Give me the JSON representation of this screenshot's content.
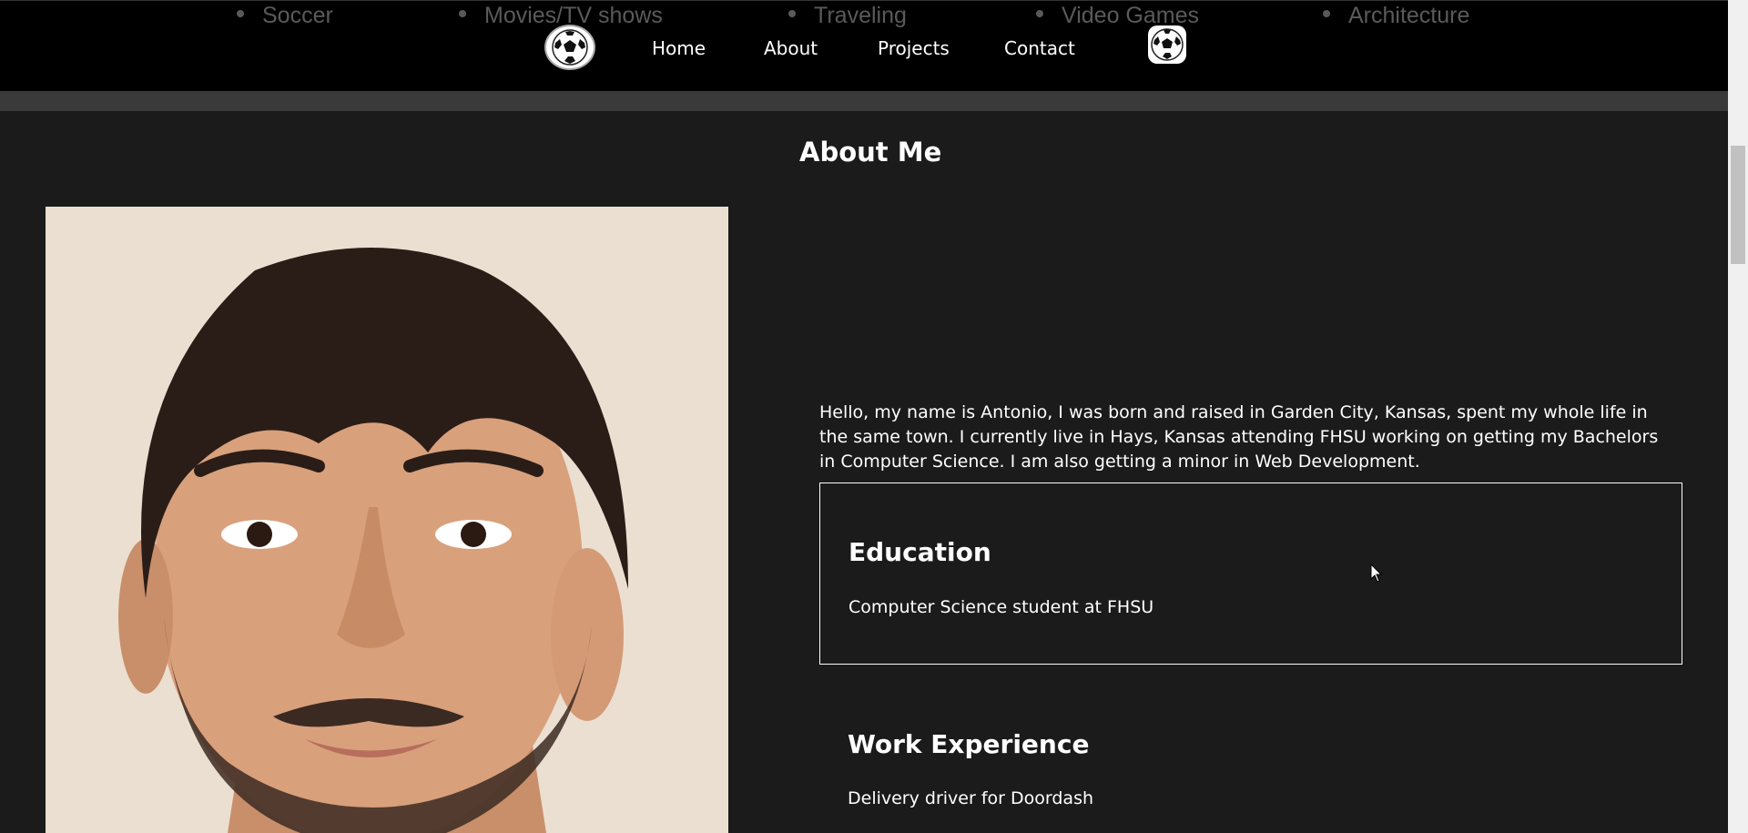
{
  "hobbies": [
    "Soccer",
    "Movies/TV shows",
    "Traveling",
    "Video Games",
    "Architecture"
  ],
  "nav": {
    "logo_left": "soccer-ball-logo",
    "links": [
      "Home",
      "About",
      "Projects",
      "Contact"
    ],
    "logo_right": "soccer-ball-logo"
  },
  "about": {
    "title": "About Me",
    "photo": "portrait-photo",
    "bio": "Hello, my name is Antonio, I was born and raised in Garden City, Kansas, spent my whole life in the same town. I currently live in Hays, Kansas attending FHSU working on getting my Bachelors in Computer Science. I am also getting a minor in Web Development."
  },
  "education": {
    "heading": "Education",
    "text": "Computer Science student at FHSU"
  },
  "work": {
    "heading": "Work Experience",
    "text": "Delivery driver for Doordash"
  },
  "colors": {
    "background": "#1b1b1b",
    "header": "#000000",
    "text": "#ffffff",
    "muted": "#5a5a5a"
  }
}
